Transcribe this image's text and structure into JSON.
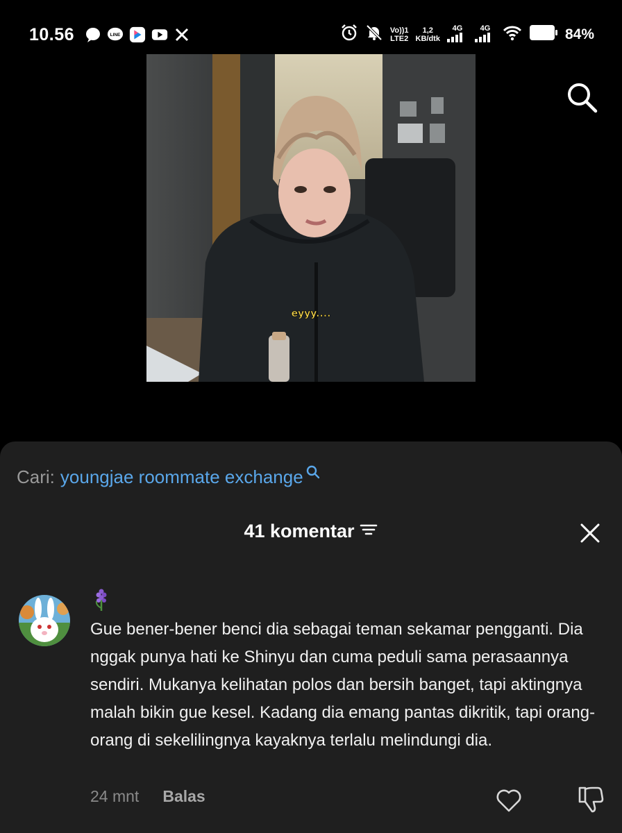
{
  "status_bar": {
    "time": "10.56",
    "volte": "Vo))1",
    "lte": "LTE2",
    "speed_value": "1,2",
    "speed_unit": "KB/dtk",
    "net1": "4G",
    "net2": "4G",
    "battery": "84%",
    "icons": [
      "message-icon",
      "line-icon",
      "youku-icon",
      "youtube-icon",
      "x-icon",
      "alarm-icon",
      "mute-icon",
      "signal-icon",
      "wifi-icon",
      "battery-icon"
    ]
  },
  "video": {
    "caption": "eyyy...."
  },
  "search_suggestion": {
    "label": "Cari:",
    "query": "youngjae roommate exchange"
  },
  "comments_header": {
    "count_label": "41 komentar"
  },
  "comment": {
    "emoji": "🪻",
    "text": "Gue bener-bener benci dia sebagai teman sekamar pengganti. Dia nggak punya hati ke Shinyu dan cuma peduli sama perasaannya sendiri. Mukanya kelihatan polos dan bersih banget, tapi aktingnya malah bikin gue kesel. Kadang dia emang pantas dikritik, tapi orang-orang di sekelilingnya kayaknya terlalu melindungi dia.",
    "time": "24 mnt",
    "reply_label": "Balas"
  },
  "colors": {
    "accent_link": "#5aa7ea",
    "sheet_bg": "#1f1f1f",
    "muted": "#8a8a8a"
  }
}
